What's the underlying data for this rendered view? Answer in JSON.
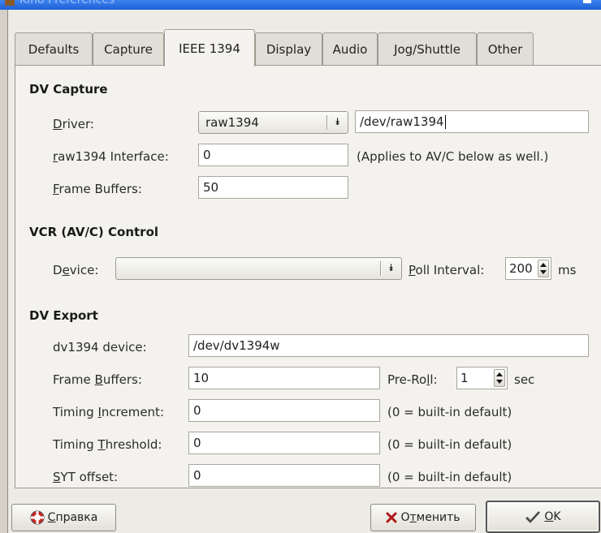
{
  "window": {
    "title": "Kino Preferences"
  },
  "tabs": [
    {
      "label": "Defaults"
    },
    {
      "label": "Capture"
    },
    {
      "label": "IEEE 1394"
    },
    {
      "label": "Display"
    },
    {
      "label": "Audio"
    },
    {
      "label": "Jog/Shuttle"
    },
    {
      "label": "Other"
    }
  ],
  "active_tab": "IEEE 1394",
  "dv_capture": {
    "heading": "DV Capture",
    "driver": {
      "label_pre": "",
      "label_ul": "D",
      "label_post": "river:",
      "value": "raw1394",
      "device_path": "/dev/raw1394"
    },
    "interface": {
      "label_ul": "r",
      "label_post": "aw1394 Interface:",
      "value": "0",
      "note": "(Applies to AV/C below as well.)"
    },
    "frame_buffers": {
      "label_ul": "F",
      "label_post": "rame Buffers:",
      "value": "50"
    }
  },
  "vcr_control": {
    "heading": "VCR (AV/C) Control",
    "device": {
      "label_pre": "D",
      "label_ul": "e",
      "label_post": "vice:",
      "value": ""
    },
    "poll_interval": {
      "label_ul": "P",
      "label_post": "oll Interval:",
      "value": "200",
      "unit": "ms"
    }
  },
  "dv_export": {
    "heading": "DV Export",
    "device": {
      "label": "dv1394 device:",
      "value": "/dev/dv1394w"
    },
    "frame_buffers": {
      "label_pre": "Frame ",
      "label_ul": "B",
      "label_post": "uffers:",
      "value": "10"
    },
    "preroll": {
      "label_pre": "Pre-Ro",
      "label_ul": "l",
      "label_post": "l:",
      "value": "1",
      "unit": "sec"
    },
    "timing_increment": {
      "label_pre": "Timing ",
      "label_ul": "I",
      "label_post": "ncrement:",
      "value": "0",
      "note": "(0 = built-in default)"
    },
    "timing_threshold": {
      "label_pre": "Timing ",
      "label_ul": "T",
      "label_post": "hreshold:",
      "value": "0",
      "note": "(0 = built-in default)"
    },
    "syt_offset": {
      "label_ul": "S",
      "label_post": "YT offset:",
      "value": "0",
      "note": "(0 = built-in default)"
    }
  },
  "buttons": {
    "help": {
      "ul": "С",
      "rest": "правка",
      "icon": "lifebuoy-icon"
    },
    "cancel": {
      "pre": "О",
      "ul": "т",
      "rest": "менить",
      "icon": "x-icon"
    },
    "ok": {
      "ul": "O",
      "rest": "K",
      "icon": "checkmark-icon"
    }
  },
  "colors": {
    "titlebar": "#1f5fd6",
    "window_bg": "#ecebe5",
    "panel_bg": "#f3f2ee",
    "cancel_icon": "#b01818"
  }
}
